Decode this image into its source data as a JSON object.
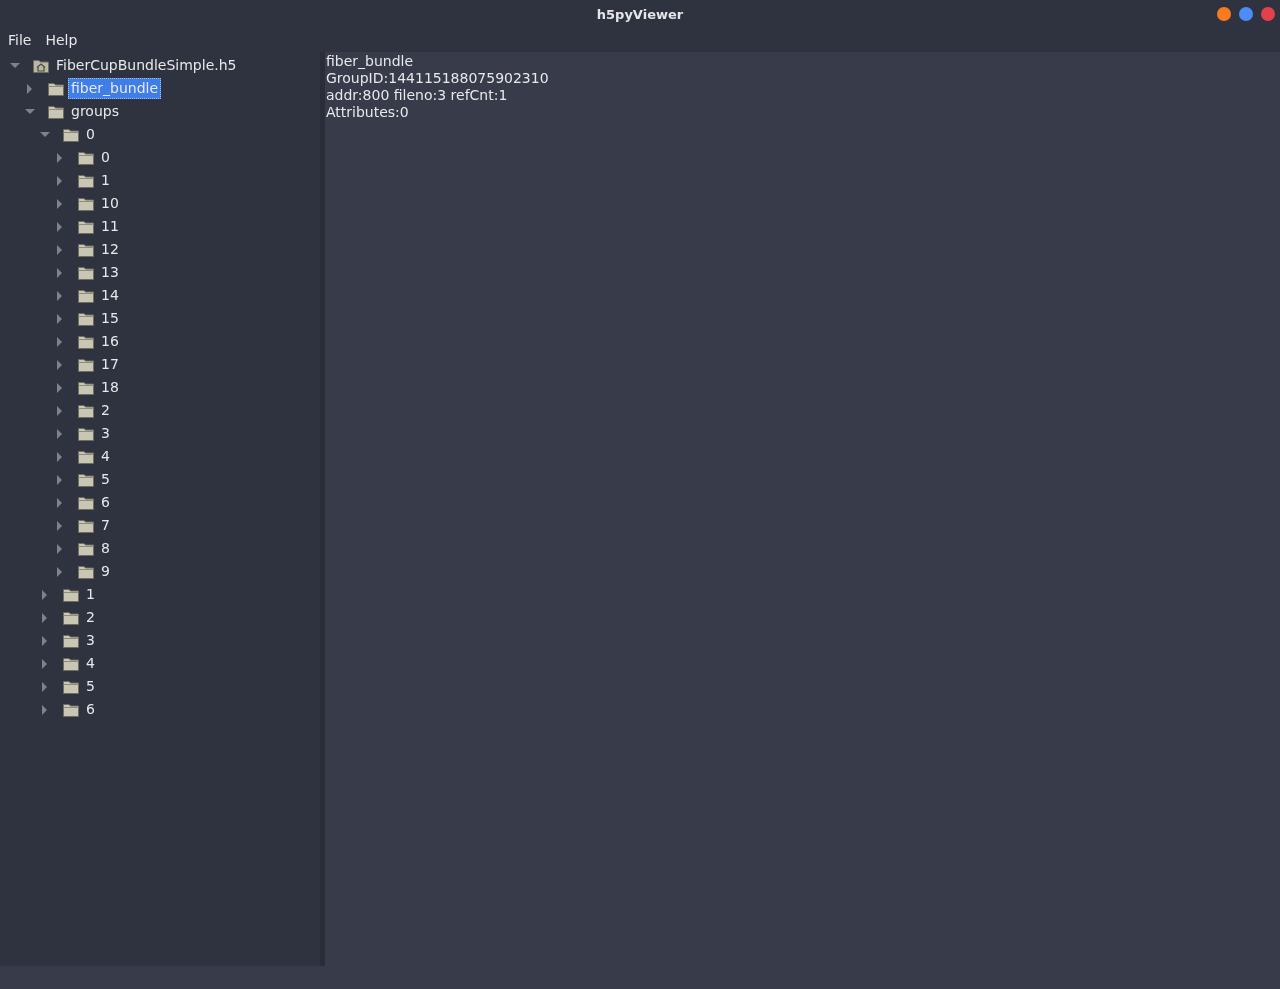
{
  "window": {
    "title": "h5pyViewer"
  },
  "menu": [
    "File",
    "Help"
  ],
  "tree": [
    {
      "label": "FiberCupBundleSimple.h5",
      "kind": "file",
      "expanded": true,
      "selected": false,
      "children": [
        {
          "label": "fiber_bundle",
          "kind": "group",
          "expanded": false,
          "selected": true
        },
        {
          "label": "groups",
          "kind": "group",
          "expanded": true,
          "selected": false,
          "children": [
            {
              "label": "0",
              "kind": "group",
              "expanded": true,
              "selected": false,
              "children": [
                {
                  "label": "0",
                  "kind": "group",
                  "expanded": false,
                  "selected": false
                },
                {
                  "label": "1",
                  "kind": "group",
                  "expanded": false,
                  "selected": false
                },
                {
                  "label": "10",
                  "kind": "group",
                  "expanded": false,
                  "selected": false
                },
                {
                  "label": "11",
                  "kind": "group",
                  "expanded": false,
                  "selected": false
                },
                {
                  "label": "12",
                  "kind": "group",
                  "expanded": false,
                  "selected": false
                },
                {
                  "label": "13",
                  "kind": "group",
                  "expanded": false,
                  "selected": false
                },
                {
                  "label": "14",
                  "kind": "group",
                  "expanded": false,
                  "selected": false
                },
                {
                  "label": "15",
                  "kind": "group",
                  "expanded": false,
                  "selected": false
                },
                {
                  "label": "16",
                  "kind": "group",
                  "expanded": false,
                  "selected": false
                },
                {
                  "label": "17",
                  "kind": "group",
                  "expanded": false,
                  "selected": false
                },
                {
                  "label": "18",
                  "kind": "group",
                  "expanded": false,
                  "selected": false
                },
                {
                  "label": "2",
                  "kind": "group",
                  "expanded": false,
                  "selected": false
                },
                {
                  "label": "3",
                  "kind": "group",
                  "expanded": false,
                  "selected": false
                },
                {
                  "label": "4",
                  "kind": "group",
                  "expanded": false,
                  "selected": false
                },
                {
                  "label": "5",
                  "kind": "group",
                  "expanded": false,
                  "selected": false
                },
                {
                  "label": "6",
                  "kind": "group",
                  "expanded": false,
                  "selected": false
                },
                {
                  "label": "7",
                  "kind": "group",
                  "expanded": false,
                  "selected": false
                },
                {
                  "label": "8",
                  "kind": "group",
                  "expanded": false,
                  "selected": false
                },
                {
                  "label": "9",
                  "kind": "group",
                  "expanded": false,
                  "selected": false
                }
              ]
            },
            {
              "label": "1",
              "kind": "group",
              "expanded": false,
              "selected": false
            },
            {
              "label": "2",
              "kind": "group",
              "expanded": false,
              "selected": false
            },
            {
              "label": "3",
              "kind": "group",
              "expanded": false,
              "selected": false
            },
            {
              "label": "4",
              "kind": "group",
              "expanded": false,
              "selected": false
            },
            {
              "label": "5",
              "kind": "group",
              "expanded": false,
              "selected": false
            },
            {
              "label": "6",
              "kind": "group",
              "expanded": false,
              "selected": false
            }
          ]
        }
      ]
    }
  ],
  "details": [
    "fiber_bundle",
    "GroupID:144115188075902310",
    "addr:800 fileno:3 refCnt:1",
    "Attributes:0"
  ]
}
